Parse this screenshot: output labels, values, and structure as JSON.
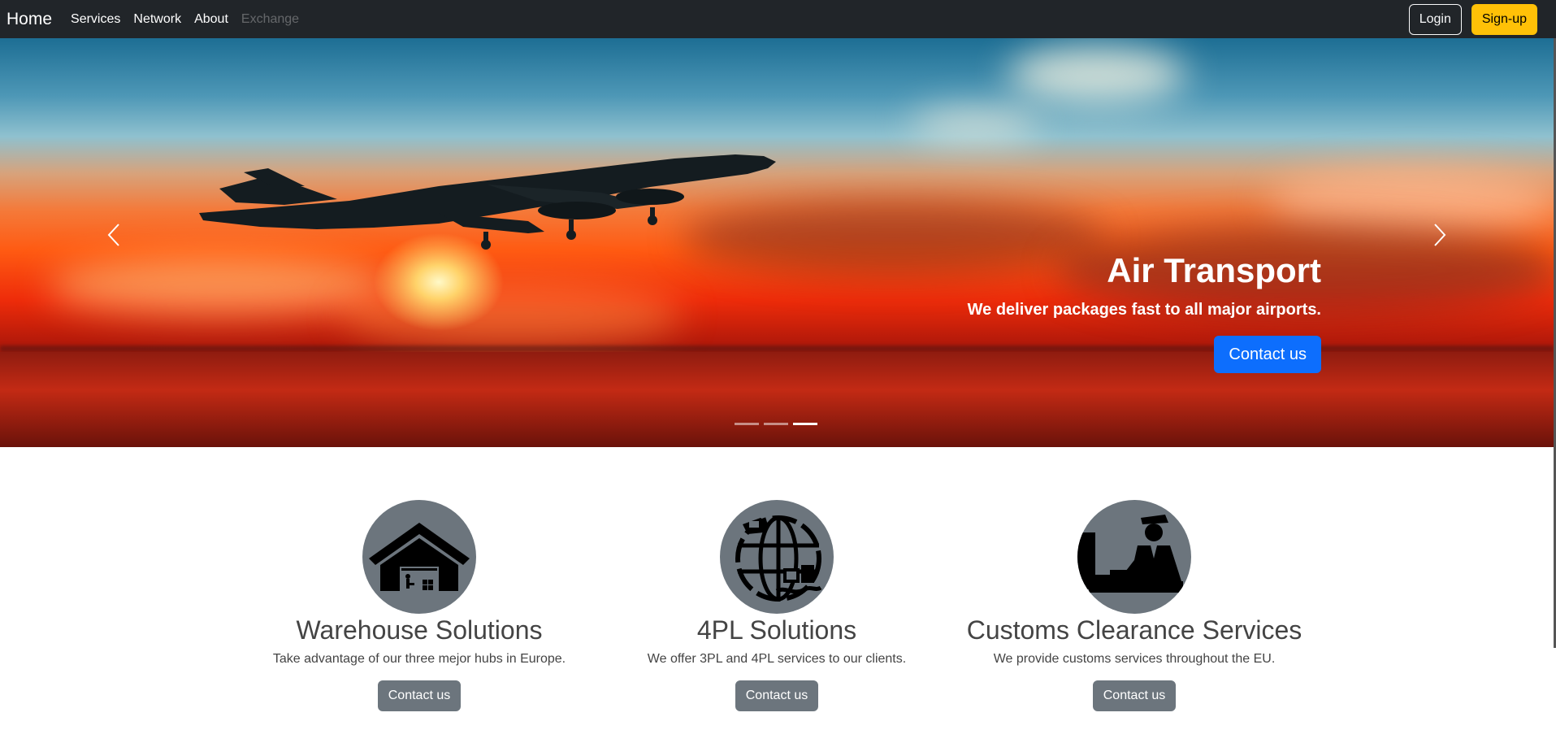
{
  "navbar": {
    "brand": "Home",
    "links": [
      "Services",
      "Network",
      "About",
      "Exchange"
    ],
    "login_label": "Login",
    "signup_label": "Sign-up"
  },
  "carousel": {
    "slide_title": "Air Transport",
    "slide_text": "We deliver packages fast to all major airports.",
    "slide_button": "Contact us",
    "slide_count": 3,
    "active_index": 2
  },
  "features": [
    {
      "title": "Warehouse Solutions",
      "text": "Take advantage of our three mejor hubs in Europe.",
      "button": "Contact us",
      "icon": "warehouse-icon"
    },
    {
      "title": "4PL Solutions",
      "text": "We offer 3PL and 4PL services to our clients.",
      "button": "Contact us",
      "icon": "globe-logistics-icon"
    },
    {
      "title": "Customs Clearance Services",
      "text": "We provide customs services throughout the EU.",
      "button": "Contact us",
      "icon": "customs-officer-icon"
    }
  ],
  "colors": {
    "navbar_bg": "#212529",
    "primary": "#0d6efd",
    "warning": "#ffc107",
    "secondary": "#6c757d"
  }
}
